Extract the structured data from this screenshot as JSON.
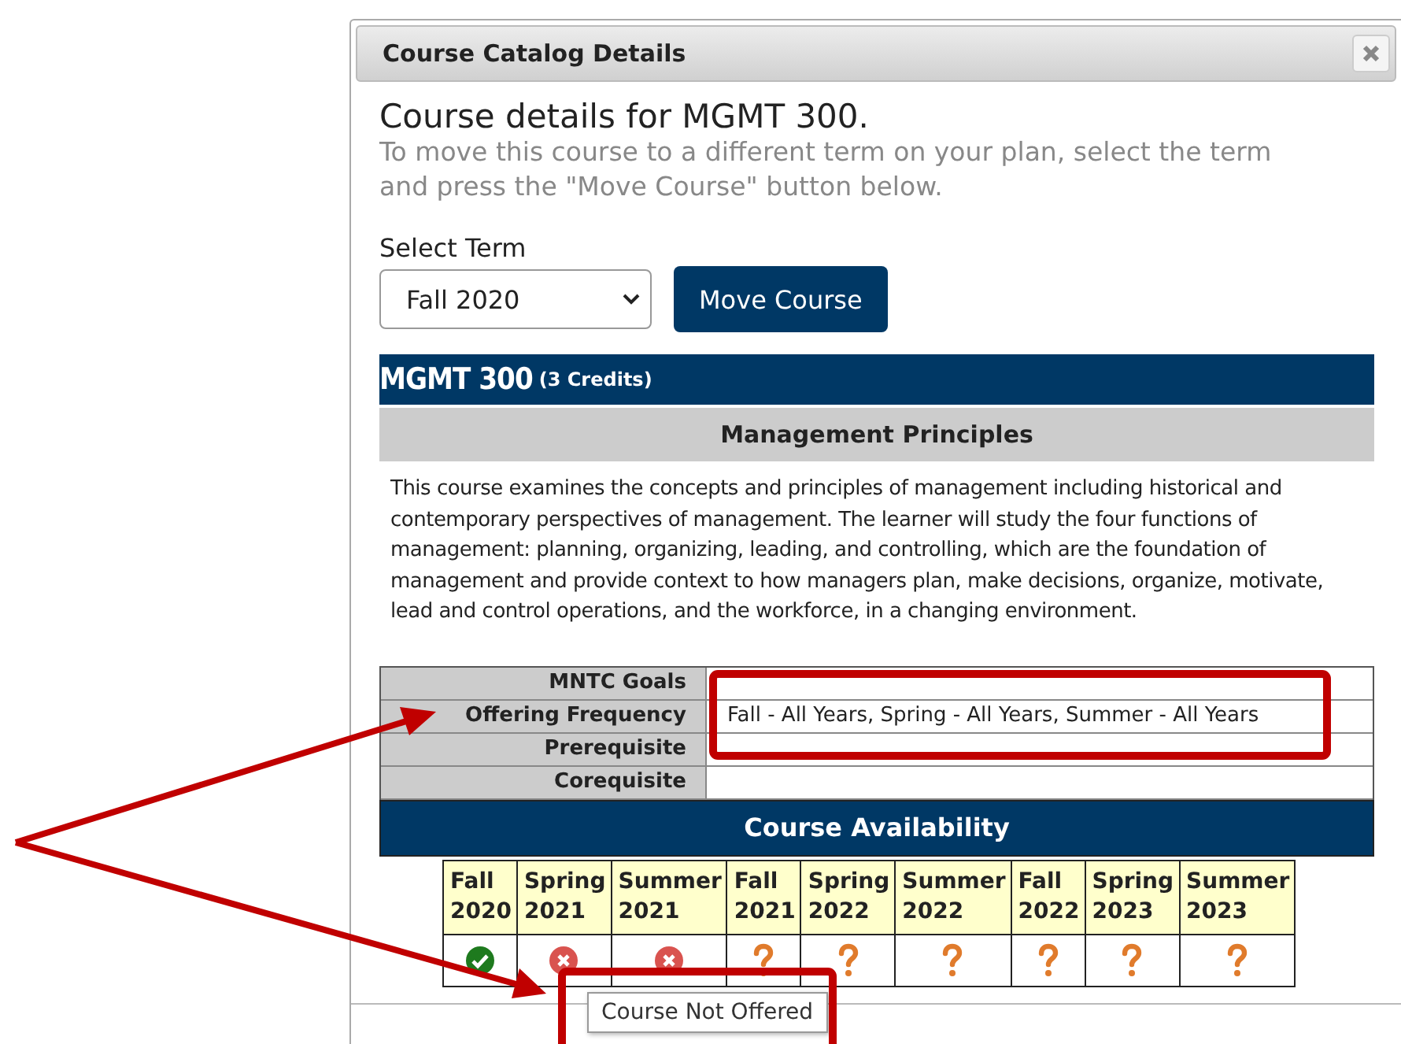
{
  "dialog": {
    "title": "Course Catalog Details"
  },
  "heading": "Course details for MGMT 300.",
  "instructions": "To move this course to a different term on your plan, select the term and press the \"Move Course\" button below.",
  "term_select": {
    "label": "Select Term",
    "value": "Fall 2020"
  },
  "move_button": "Move Course",
  "course": {
    "code": "MGMT 300",
    "credits": "(3 Credits)",
    "name": "Management Principles",
    "description": "This course examines the concepts and principles of management including historical and contemporary perspectives of management. The learner will study the four functions of management: planning, organizing, leading, and controlling, which are the foundation of management and provide context to how managers plan, make decisions, organize, motivate, lead and control operations, and the workforce, in a changing environment."
  },
  "info_rows": [
    {
      "label": "MNTC Goals"
    },
    {
      "label": "Offering Frequency",
      "value": "Fall - All Years, Spring - All Years, Summer - All Years"
    },
    {
      "label": "Prerequisite"
    },
    {
      "label": "Corequisite"
    }
  ],
  "availability": {
    "title": "Course Availability",
    "terms": [
      {
        "season": "Fall",
        "year": "2020",
        "kind": "offered"
      },
      {
        "season": "Spring",
        "year": "2021",
        "kind": "unavailable"
      },
      {
        "season": "Summer",
        "year": "2021",
        "kind": "unavailable"
      },
      {
        "season": "Fall",
        "year": "2021",
        "kind": "unknown"
      },
      {
        "season": "Spring",
        "year": "2022",
        "kind": "unknown"
      },
      {
        "season": "Summer",
        "year": "2022",
        "kind": "unknown"
      },
      {
        "season": "Fall",
        "year": "2022",
        "kind": "unknown"
      },
      {
        "season": "Spring",
        "year": "2023",
        "kind": "unknown"
      },
      {
        "season": "Summer",
        "year": "2023",
        "kind": "unknown"
      }
    ]
  },
  "tooltip": "Course Not Offered"
}
